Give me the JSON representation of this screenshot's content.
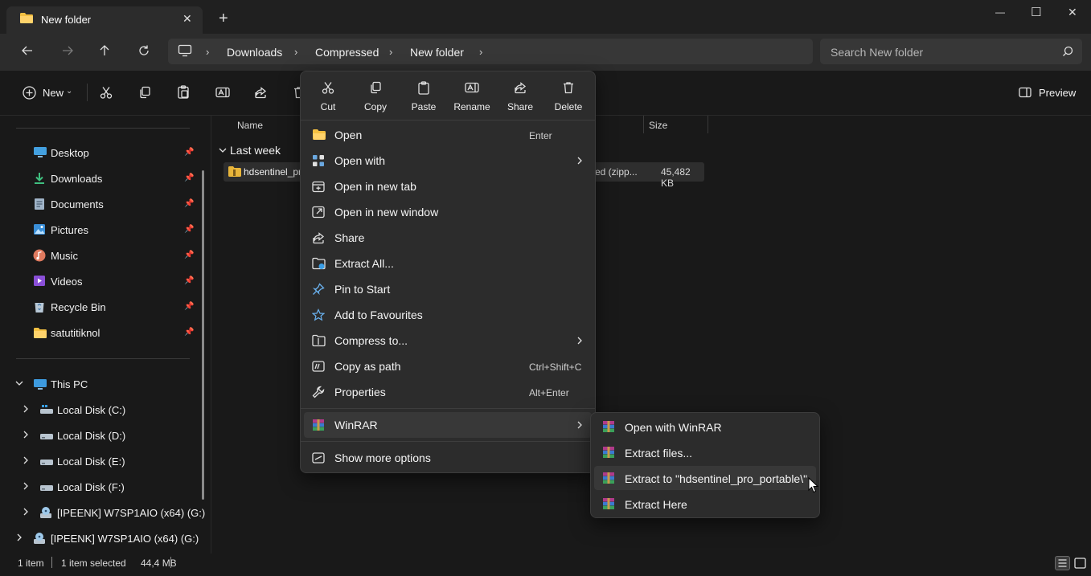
{
  "window": {
    "tab_title": "New folder",
    "new_tab_label": "+",
    "controls": {
      "minimize": "—",
      "maximize": "☐",
      "close": "✕"
    }
  },
  "nav": {
    "breadcrumb": [
      "Downloads",
      "Compressed",
      "New folder"
    ],
    "search_placeholder": "Search New folder"
  },
  "commandbar": {
    "new_label": "New",
    "preview_label": "Preview"
  },
  "sidebar": {
    "quick_access": [
      {
        "label": "Desktop",
        "icon": "desktop-icon"
      },
      {
        "label": "Downloads",
        "icon": "downloads-icon"
      },
      {
        "label": "Documents",
        "icon": "documents-icon"
      },
      {
        "label": "Pictures",
        "icon": "pictures-icon"
      },
      {
        "label": "Music",
        "icon": "music-icon"
      },
      {
        "label": "Videos",
        "icon": "videos-icon"
      },
      {
        "label": "Recycle Bin",
        "icon": "recycle-bin-icon"
      },
      {
        "label": "satutitiknol",
        "icon": "folder-icon"
      }
    ],
    "this_pc": "This PC",
    "drives": [
      {
        "label": "Local Disk (C:)"
      },
      {
        "label": "Local Disk (D:)"
      },
      {
        "label": "Local Disk (E:)"
      },
      {
        "label": "Local Disk (F:)"
      },
      {
        "label": "[IPEENK] W7SP1AIO (x64) (G:)"
      }
    ],
    "root_drive": "[IPEENK] W7SP1AIO (x64) (G:)"
  },
  "filelist": {
    "columns": {
      "name": "Name",
      "size": "Size"
    },
    "group": "Last week",
    "files": [
      {
        "name": "hdsentinel_pro",
        "type": "ed (zipp...",
        "size": "45,482 KB"
      }
    ]
  },
  "context_menu": {
    "quick_actions": [
      {
        "label": "Cut",
        "icon": "cut-icon"
      },
      {
        "label": "Copy",
        "icon": "copy-icon"
      },
      {
        "label": "Paste",
        "icon": "paste-icon"
      },
      {
        "label": "Rename",
        "icon": "rename-icon"
      },
      {
        "label": "Share",
        "icon": "share-icon"
      },
      {
        "label": "Delete",
        "icon": "delete-icon"
      }
    ],
    "items": [
      {
        "label": "Open",
        "shortcut": "Enter"
      },
      {
        "label": "Open with",
        "shortcut": ""
      },
      {
        "label": "Open in new tab",
        "shortcut": ""
      },
      {
        "label": "Open in new window",
        "shortcut": ""
      },
      {
        "label": "Share",
        "shortcut": ""
      },
      {
        "label": "Extract All...",
        "shortcut": ""
      },
      {
        "label": "Pin to Start",
        "shortcut": ""
      },
      {
        "label": "Add to Favourites",
        "shortcut": ""
      },
      {
        "label": "Compress to...",
        "shortcut": ""
      },
      {
        "label": "Copy as path",
        "shortcut": "Ctrl+Shift+C"
      },
      {
        "label": "Properties",
        "shortcut": "Alt+Enter"
      }
    ],
    "winrar": "WinRAR",
    "show_more": "Show more options"
  },
  "submenu": {
    "items": [
      {
        "label": "Open with WinRAR"
      },
      {
        "label": "Extract files..."
      },
      {
        "label": "Extract to \"hdsentinel_pro_portable\\\""
      },
      {
        "label": "Extract Here"
      }
    ]
  },
  "status": {
    "items_count": "1 item",
    "selected": "1 item selected",
    "size": "44,4 MB"
  }
}
